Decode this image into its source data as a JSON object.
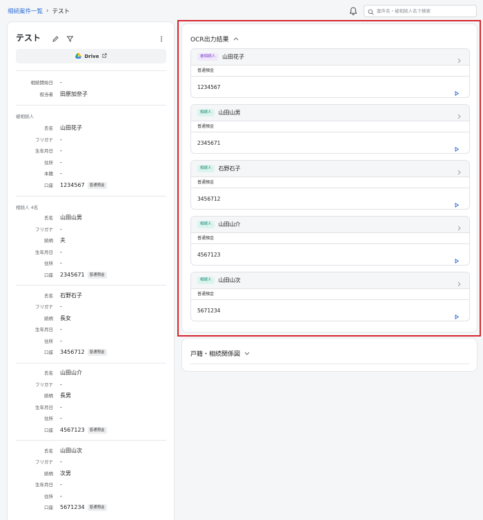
{
  "breadcrumb": {
    "parent": "相続案件一覧",
    "separator": "›",
    "current": "テスト"
  },
  "search": {
    "placeholder": "案件名・被相続人名で検索"
  },
  "case": {
    "title": "テスト",
    "drive_label": "Drive",
    "summary": [
      {
        "label": "相続開始日",
        "value": "-"
      },
      {
        "label": "担当者",
        "value": "田原加奈子"
      }
    ],
    "decedent_section": "被相続人",
    "decedent": [
      {
        "label": "氏名",
        "value": "山田花子"
      },
      {
        "label": "フリガナ",
        "value": "-"
      },
      {
        "label": "生年月日",
        "value": "-"
      },
      {
        "label": "住所",
        "value": "-"
      },
      {
        "label": "本籍",
        "value": "-"
      },
      {
        "label": "口座",
        "value": "1234567",
        "tag": "普通預金"
      }
    ],
    "heirs_section": "相続人 4名",
    "heirs": [
      {
        "fields": [
          {
            "label": "氏名",
            "value": "山田山男"
          },
          {
            "label": "フリガナ",
            "value": "-"
          },
          {
            "label": "続柄",
            "value": "夫"
          },
          {
            "label": "生年月日",
            "value": "-"
          },
          {
            "label": "住所",
            "value": "-"
          },
          {
            "label": "口座",
            "value": "2345671",
            "tag": "普通預金"
          }
        ]
      },
      {
        "fields": [
          {
            "label": "氏名",
            "value": "石野石子"
          },
          {
            "label": "フリガナ",
            "value": "-"
          },
          {
            "label": "続柄",
            "value": "長女"
          },
          {
            "label": "生年月日",
            "value": "-"
          },
          {
            "label": "住所",
            "value": "-"
          },
          {
            "label": "口座",
            "value": "3456712",
            "tag": "普通預金"
          }
        ]
      },
      {
        "fields": [
          {
            "label": "氏名",
            "value": "山田山介"
          },
          {
            "label": "フリガナ",
            "value": "-"
          },
          {
            "label": "続柄",
            "value": "長男"
          },
          {
            "label": "生年月日",
            "value": "-"
          },
          {
            "label": "住所",
            "value": "-"
          },
          {
            "label": "口座",
            "value": "4567123",
            "tag": "普通預金"
          }
        ]
      },
      {
        "fields": [
          {
            "label": "氏名",
            "value": "山田山次"
          },
          {
            "label": "フリガナ",
            "value": "-"
          },
          {
            "label": "続柄",
            "value": "次男"
          },
          {
            "label": "生年月日",
            "value": "-"
          },
          {
            "label": "住所",
            "value": "-"
          },
          {
            "label": "口座",
            "value": "5671234",
            "tag": "普通預金"
          }
        ]
      }
    ]
  },
  "ocr": {
    "title": "OCR出力結果",
    "cards": [
      {
        "badge": "被相続人",
        "badge_color": "#7b3fc4",
        "name": "山田花子",
        "account_type": "普通預金",
        "account_number": "1234567"
      },
      {
        "badge": "相続人",
        "badge_color": "#15856e",
        "name": "山田山男",
        "account_type": "普通預金",
        "account_number": "2345671"
      },
      {
        "badge": "相続人",
        "badge_color": "#15856e",
        "name": "石野石子",
        "account_type": "普通預金",
        "account_number": "3456712"
      },
      {
        "badge": "相続人",
        "badge_color": "#15856e",
        "name": "山田山介",
        "account_type": "普通預金",
        "account_number": "4567123"
      },
      {
        "badge": "相続人",
        "badge_color": "#15856e",
        "name": "山田山次",
        "account_type": "普通預金",
        "account_number": "5671234"
      }
    ]
  },
  "koseki": {
    "title": "戸籍・相続関係図"
  },
  "colors": {
    "accent": "#2f6fd6",
    "highlight_frame": "#d6242c",
    "icon_blue": "#3b6fd8"
  }
}
